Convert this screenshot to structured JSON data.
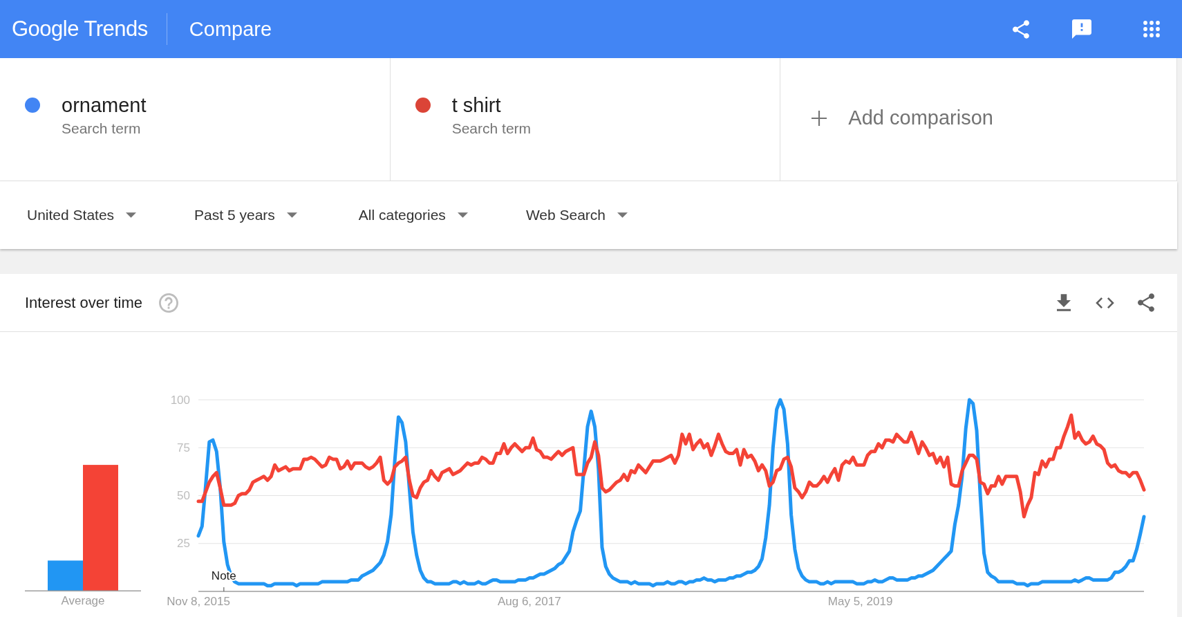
{
  "header": {
    "logo": "Google Trends",
    "title": "Compare"
  },
  "terms": [
    {
      "name": "ornament",
      "type": "Search term",
      "color": "#4285f4"
    },
    {
      "name": "t shirt",
      "type": "Search term",
      "color": "#db4437"
    }
  ],
  "add_comparison": {
    "label": "Add comparison"
  },
  "filters": [
    "United States",
    "Past 5 years",
    "All categories",
    "Web Search"
  ],
  "interest_over_time": {
    "title": "Interest over time",
    "average_label": "Average",
    "note_label": "Note",
    "chart_data": {
      "type": "line",
      "grid": true,
      "categories": [
        "Nov 8, 2015",
        null,
        null,
        null,
        null,
        null,
        null,
        null,
        null,
        null,
        null,
        null,
        null,
        null,
        null,
        null,
        null,
        null,
        null,
        null,
        null,
        null,
        null,
        null,
        null,
        null,
        null,
        null,
        null,
        null,
        null,
        null,
        null,
        null,
        null,
        null,
        null,
        null,
        null,
        null,
        null,
        null,
        null,
        null,
        null,
        null,
        null,
        null,
        null,
        null,
        null,
        null,
        null,
        null,
        null,
        null,
        null,
        null,
        null,
        null,
        null,
        null,
        null,
        null,
        null,
        null,
        null,
        null,
        null,
        null,
        null,
        null,
        null,
        null,
        null,
        null,
        null,
        null,
        null,
        null,
        null,
        null,
        null,
        null,
        null,
        null,
        null,
        null,
        null,
        null,
        null,
        "Aug 6, 2017",
        null,
        null,
        null,
        null,
        null,
        null,
        null,
        null,
        null,
        null,
        null,
        null,
        null,
        null,
        null,
        null,
        null,
        null,
        null,
        null,
        null,
        null,
        null,
        null,
        null,
        null,
        null,
        null,
        null,
        null,
        null,
        null,
        null,
        null,
        null,
        null,
        null,
        null,
        null,
        null,
        null,
        null,
        null,
        null,
        null,
        null,
        null,
        null,
        null,
        null,
        null,
        null,
        null,
        null,
        null,
        null,
        null,
        null,
        null,
        null,
        null,
        null,
        null,
        null,
        null,
        null,
        null,
        null,
        null,
        null,
        null,
        null,
        null,
        null,
        null,
        null,
        null,
        null,
        null,
        null,
        null,
        null,
        null,
        null,
        null,
        null,
        null,
        null,
        null,
        null,
        "May 5, 2019",
        null,
        null,
        null,
        null,
        null,
        null,
        null,
        null,
        null,
        null,
        null,
        null,
        null,
        null,
        null,
        null,
        null,
        null,
        null,
        null,
        null,
        null,
        null,
        null,
        null,
        null,
        null,
        null,
        null,
        null,
        null,
        null,
        null,
        null,
        null,
        null,
        null,
        null,
        null,
        null,
        null,
        null,
        null,
        null,
        null,
        null,
        null,
        null,
        null,
        null,
        null,
        null,
        null,
        null,
        null,
        null,
        null,
        null,
        null,
        null,
        null,
        null,
        null,
        null,
        null,
        null,
        null,
        null,
        null,
        null,
        null,
        null,
        null,
        null,
        null,
        null,
        null,
        null
      ],
      "ylim": [
        0,
        100
      ],
      "yticks": [
        25,
        50,
        75,
        100
      ],
      "series": [
        {
          "color": "#2196f3",
          "values": [
            29,
            34,
            55,
            78,
            79,
            73,
            54,
            26,
            14,
            8,
            5,
            4,
            4,
            4,
            4,
            4,
            4,
            4,
            4,
            3,
            3,
            4,
            4,
            4,
            4,
            4,
            4,
            3,
            4,
            4,
            4,
            4,
            4,
            4,
            5,
            5,
            5,
            5,
            5,
            5,
            5,
            5,
            6,
            6,
            6,
            8,
            9,
            10,
            11,
            13,
            15,
            19,
            26,
            40,
            68,
            91,
            88,
            78,
            54,
            31,
            19,
            11,
            7,
            5,
            5,
            4,
            4,
            4,
            4,
            4,
            5,
            5,
            4,
            5,
            4,
            4,
            4,
            5,
            4,
            4,
            5,
            6,
            6,
            5,
            5,
            5,
            5,
            5,
            6,
            6,
            6,
            7,
            7,
            8,
            9,
            9,
            10,
            11,
            12,
            14,
            15,
            18,
            21,
            31,
            37,
            42,
            64,
            86,
            94,
            86,
            64,
            23,
            13,
            9,
            7,
            6,
            5,
            5,
            5,
            4,
            5,
            4,
            4,
            4,
            4,
            3,
            4,
            4,
            4,
            5,
            4,
            4,
            5,
            5,
            4,
            5,
            5,
            6,
            6,
            7,
            6,
            6,
            5,
            6,
            6,
            6,
            7,
            7,
            8,
            8,
            9,
            10,
            10,
            11,
            13,
            17,
            28,
            45,
            75,
            95,
            100,
            95,
            77,
            40,
            22,
            12,
            8,
            6,
            5,
            5,
            5,
            4,
            4,
            5,
            4,
            5,
            5,
            5,
            5,
            5,
            5,
            4,
            4,
            4,
            5,
            5,
            6,
            5,
            5,
            6,
            7,
            7,
            6,
            6,
            6,
            6,
            7,
            7,
            8,
            8,
            9,
            10,
            11,
            13,
            15,
            17,
            19,
            21,
            35,
            45,
            60,
            85,
            100,
            98,
            84,
            50,
            20,
            10,
            8,
            7,
            5,
            5,
            5,
            5,
            5,
            4,
            4,
            4,
            3,
            4,
            4,
            4,
            5,
            5,
            5,
            5,
            5,
            5,
            5,
            5,
            5,
            6,
            5,
            6,
            7,
            7,
            6,
            6,
            6,
            6,
            6,
            7,
            10,
            10,
            11,
            13,
            16,
            16,
            22,
            30,
            39
          ]
        },
        {
          "color": "#f44336",
          "values": [
            47,
            47,
            52,
            57,
            60,
            62,
            54,
            45,
            45,
            45,
            46,
            50,
            51,
            51,
            53,
            57,
            58,
            59,
            60,
            58,
            60,
            66,
            63,
            64,
            65,
            63,
            64,
            64,
            64,
            69,
            69,
            70,
            69,
            67,
            65,
            66,
            70,
            69,
            69,
            64,
            65,
            68,
            64,
            67,
            67,
            67,
            65,
            64,
            65,
            67,
            70,
            58,
            56,
            58,
            65,
            67,
            68,
            70,
            58,
            50,
            49,
            54,
            57,
            58,
            63,
            60,
            58,
            62,
            63,
            64,
            61,
            62,
            63,
            65,
            67,
            66,
            67,
            67,
            70,
            69,
            67,
            67,
            72,
            72,
            77,
            72,
            75,
            77,
            75,
            73,
            75,
            75,
            80,
            74,
            73,
            70,
            70,
            69,
            71,
            73,
            71,
            73,
            74,
            75,
            61,
            61,
            61,
            67,
            70,
            78,
            71,
            54,
            52,
            53,
            55,
            57,
            58,
            61,
            58,
            63,
            62,
            66,
            64,
            62,
            65,
            68,
            68,
            68,
            69,
            70,
            71,
            67,
            71,
            82,
            77,
            82,
            74,
            77,
            79,
            75,
            77,
            71,
            76,
            82,
            77,
            73,
            72,
            72,
            74,
            66,
            74,
            70,
            71,
            68,
            63,
            66,
            63,
            55,
            57,
            63,
            64,
            69,
            70,
            65,
            54,
            52,
            49,
            52,
            57,
            55,
            55,
            57,
            60,
            57,
            61,
            64,
            58,
            66,
            68,
            67,
            70,
            66,
            66,
            66,
            71,
            73,
            73,
            77,
            75,
            79,
            79,
            78,
            82,
            80,
            78,
            78,
            83,
            78,
            72,
            78,
            75,
            71,
            72,
            67,
            70,
            65,
            70,
            56,
            55,
            55,
            63,
            67,
            71,
            71,
            69,
            57,
            56,
            51,
            55,
            55,
            60,
            56,
            60,
            60,
            60,
            60,
            52,
            39,
            45,
            49,
            62,
            61,
            68,
            65,
            69,
            69,
            75,
            75,
            81,
            86,
            92,
            80,
            83,
            79,
            77,
            78,
            81,
            77,
            76,
            74,
            67,
            65,
            66,
            63,
            62,
            62,
            60,
            62,
            62,
            58,
            53
          ]
        }
      ]
    }
  }
}
